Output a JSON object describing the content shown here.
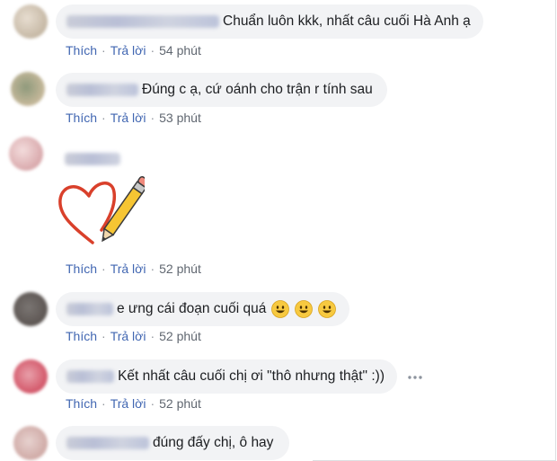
{
  "icons": {
    "more": "more-horizontal-icon",
    "emoji": "grinning-face-emoji",
    "sticker": "heart-pencil-sticker"
  },
  "colors": {
    "link": "#4267b2",
    "bubble": "#f2f3f5",
    "time": "#606770"
  },
  "comments": [
    {
      "text": "Chuẩn luôn kkk, nhất câu cuối Hà Anh ạ",
      "like": "Thích",
      "reply": "Trả lời",
      "time": "54 phút"
    },
    {
      "text": "Đúng c ạ, cứ oánh cho trận r tính sau",
      "like": "Thích",
      "reply": "Trả lời",
      "time": "53 phút"
    },
    {
      "like": "Thích",
      "reply": "Trả lời",
      "time": "52 phút"
    },
    {
      "text": "e ưng cái đoạn cuối quá",
      "like": "Thích",
      "reply": "Trả lời",
      "time": "52 phút"
    },
    {
      "text": "Kết nhất câu cuối chị ơi \"thô nhưng thật\" :))",
      "like": "Thích",
      "reply": "Trả lời",
      "time": "52 phút"
    },
    {
      "text": "đúng đấy chị, ô hay"
    }
  ]
}
